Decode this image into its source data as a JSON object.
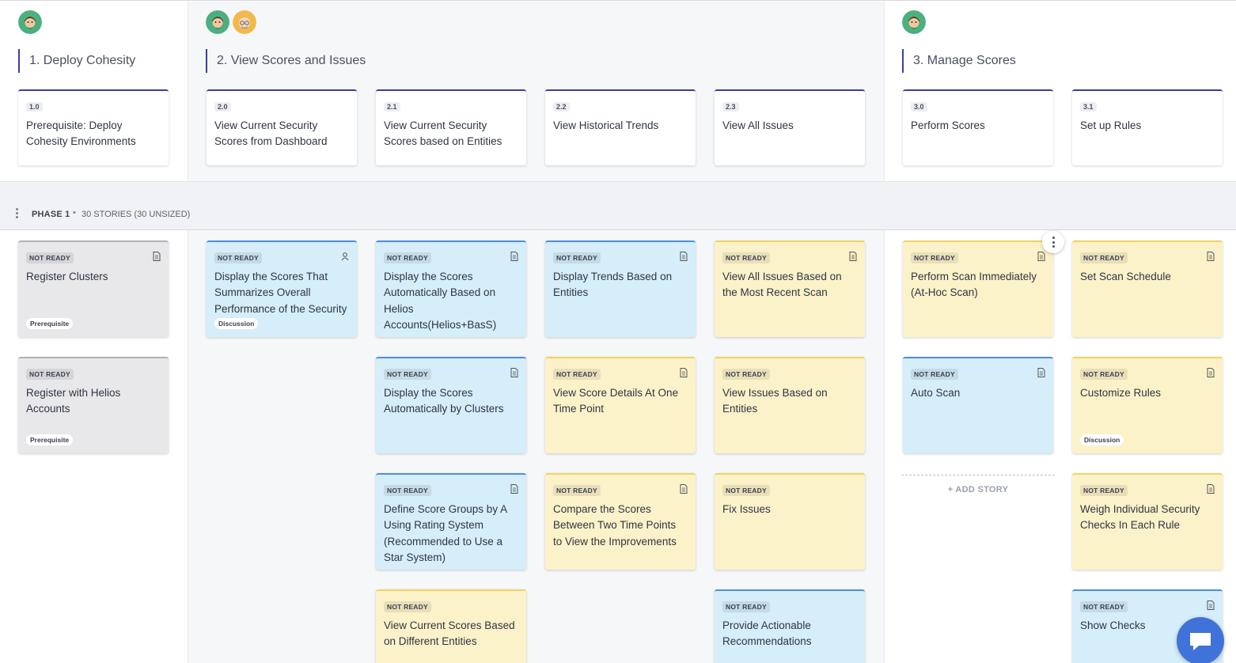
{
  "activities": [
    {
      "label": "1. Deploy Cohesity"
    },
    {
      "label": "2. View Scores and Issues"
    },
    {
      "label": "3. Manage Scores"
    }
  ],
  "steps": [
    {
      "num": "1.0",
      "title": "Prerequisite: Deploy Cohesity Environments"
    },
    {
      "num": "2.0",
      "title": "View Current Security Scores from Dashboard"
    },
    {
      "num": "2.1",
      "title": "View Current Security Scores based on Entities"
    },
    {
      "num": "2.2",
      "title": "View Historical Trends"
    },
    {
      "num": "2.3",
      "title": "View All Issues"
    },
    {
      "num": "3.0",
      "title": "Perform Scores"
    },
    {
      "num": "3.1",
      "title": "Set up Rules"
    }
  ],
  "phase": {
    "title": "PHASE 1",
    "separator": "•",
    "count": "30 STORIES (30 UNSIZED)"
  },
  "stories": [
    {
      "status": "NOT READY",
      "title": "Register Clusters",
      "tag": "Prerequisite",
      "icon": "doc-icon",
      "color": "gray"
    },
    {
      "status": "NOT READY",
      "title": "Register with Helios Accounts",
      "tag": "Prerequisite",
      "icon": "",
      "color": "gray"
    },
    {
      "status": "NOT READY",
      "title": "Display the Scores That Summarizes Overall Performance of the Security",
      "tag": "Discussion",
      "icon": "user-icon",
      "color": "blue"
    },
    {
      "status": "NOT READY",
      "title": "Display the Scores Automatically Based on Helios Accounts(Helios+BasS)",
      "tag": "",
      "icon": "doc-icon",
      "color": "blue"
    },
    {
      "status": "NOT READY",
      "title": "Display the Scores Automatically by Clusters",
      "tag": "",
      "icon": "doc-icon",
      "color": "blue"
    },
    {
      "status": "NOT READY",
      "title": "Define Score Groups by A Using Rating System (Recommended to Use a Star System)",
      "tag": "",
      "icon": "doc-icon",
      "color": "blue"
    },
    {
      "status": "NOT READY",
      "title": "View Current Scores Based on Different Entities",
      "tag": "",
      "icon": "",
      "color": "yellow"
    },
    {
      "status": "NOT READY",
      "title": "Display Trends Based on Entities",
      "tag": "",
      "icon": "doc-icon",
      "color": "blue"
    },
    {
      "status": "NOT READY",
      "title": "View Score Details At One Time Point",
      "tag": "",
      "icon": "doc-icon",
      "color": "yellow"
    },
    {
      "status": "NOT READY",
      "title": "Compare the Scores Between Two Time Points to View the Improvements",
      "tag": "",
      "icon": "doc-icon",
      "color": "yellow"
    },
    {
      "status": "NOT READY",
      "title": "View All Issues Based on the Most Recent Scan",
      "tag": "",
      "icon": "doc-icon",
      "color": "yellow"
    },
    {
      "status": "NOT READY",
      "title": "View Issues Based on Entities",
      "tag": "",
      "icon": "",
      "color": "yellow"
    },
    {
      "status": "NOT READY",
      "title": "Fix Issues",
      "tag": "",
      "icon": "",
      "color": "yellow"
    },
    {
      "status": "NOT READY",
      "title": "Provide Actionable Recommendations",
      "tag": "",
      "icon": "",
      "color": "blue"
    },
    {
      "status": "NOT READY",
      "title": "Perform Scan Immediately (At-Hoc Scan)",
      "tag": "",
      "icon": "doc-icon",
      "color": "yellow"
    },
    {
      "status": "NOT READY",
      "title": "Auto Scan",
      "tag": "",
      "icon": "doc-icon",
      "color": "blue"
    },
    {
      "status": "NOT READY",
      "title": "Set Scan Schedule",
      "tag": "",
      "icon": "doc-icon",
      "color": "yellow"
    },
    {
      "status": "NOT READY",
      "title": "Customize Rules",
      "tag": "Discussion",
      "icon": "doc-icon",
      "color": "yellow"
    },
    {
      "status": "NOT READY",
      "title": "Weigh Individual Security Checks In Each Rule",
      "tag": "",
      "icon": "doc-icon",
      "color": "yellow"
    },
    {
      "status": "NOT READY",
      "title": "Show Checks",
      "tag": "",
      "icon": "doc-icon",
      "color": "blue"
    }
  ],
  "add_story": {
    "label": "+ ADD STORY"
  },
  "colors": {
    "accent": "#3b3f9e",
    "blue_card": "#d5eef9",
    "yellow_card": "#fcf2c9",
    "gray_card": "#e8e8ea",
    "chat": "#3f73d9"
  }
}
